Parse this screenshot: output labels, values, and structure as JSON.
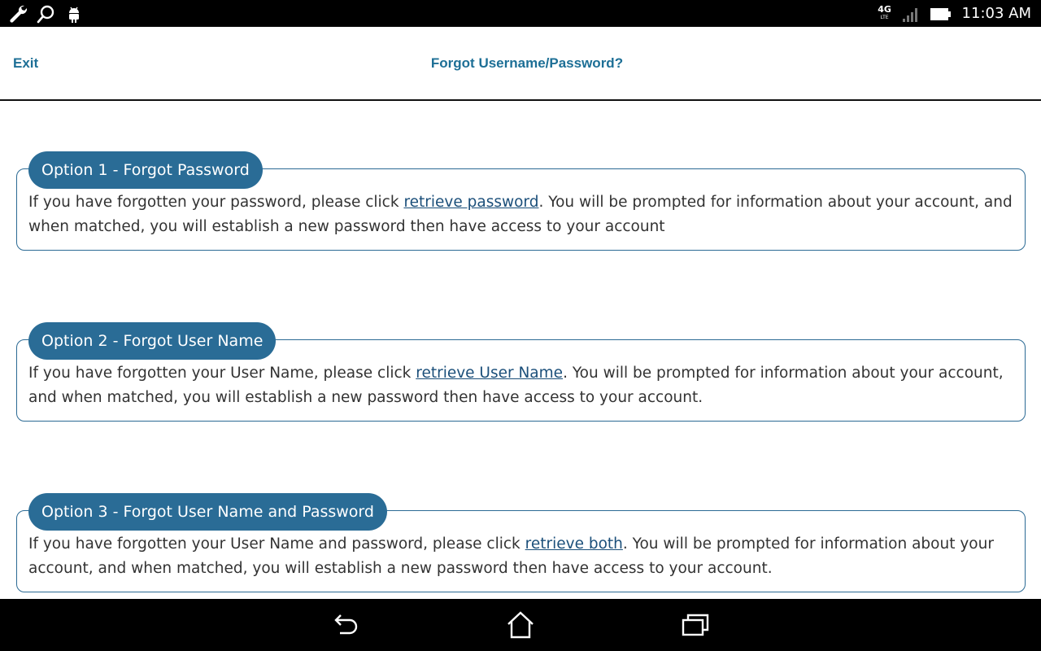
{
  "status_bar": {
    "left_icons": [
      "wrench-icon",
      "search-icon",
      "android-icon"
    ],
    "network_label": "4G",
    "network_sublabel": "LTE",
    "time": "11:03 AM"
  },
  "header": {
    "exit_label": "Exit",
    "title": "Forgot Username/Password?"
  },
  "options": [
    {
      "tab_label": "Option 1 - Forgot Password",
      "text_before": "If you have forgotten your password, please click ",
      "link_label": "retrieve password",
      "text_after": ". You will be prompted for information about your account, and when matched, you will establish a new password then have access to your account"
    },
    {
      "tab_label": "Option 2 - Forgot User Name",
      "text_before": "If you have forgotten your User Name, please click ",
      "link_label": "retrieve User Name",
      "text_after": ". You will be prompted for information about your account, and when matched, you will establish a new password then have access to your account."
    },
    {
      "tab_label": "Option 3 - Forgot User Name and Password",
      "text_before": "If you have forgotten your User Name and password, please click ",
      "link_label": "retrieve both",
      "text_after": ". You will be prompted for information about your account, and when matched, you will establish a new password then have access to your account."
    }
  ],
  "nav_bar": {
    "buttons": [
      "back-icon",
      "home-icon",
      "recent-apps-icon"
    ]
  },
  "colors": {
    "accent": "#1d6f96",
    "tab_background": "#2a6c96",
    "link": "#1b4f7a",
    "body_text": "#333333"
  }
}
